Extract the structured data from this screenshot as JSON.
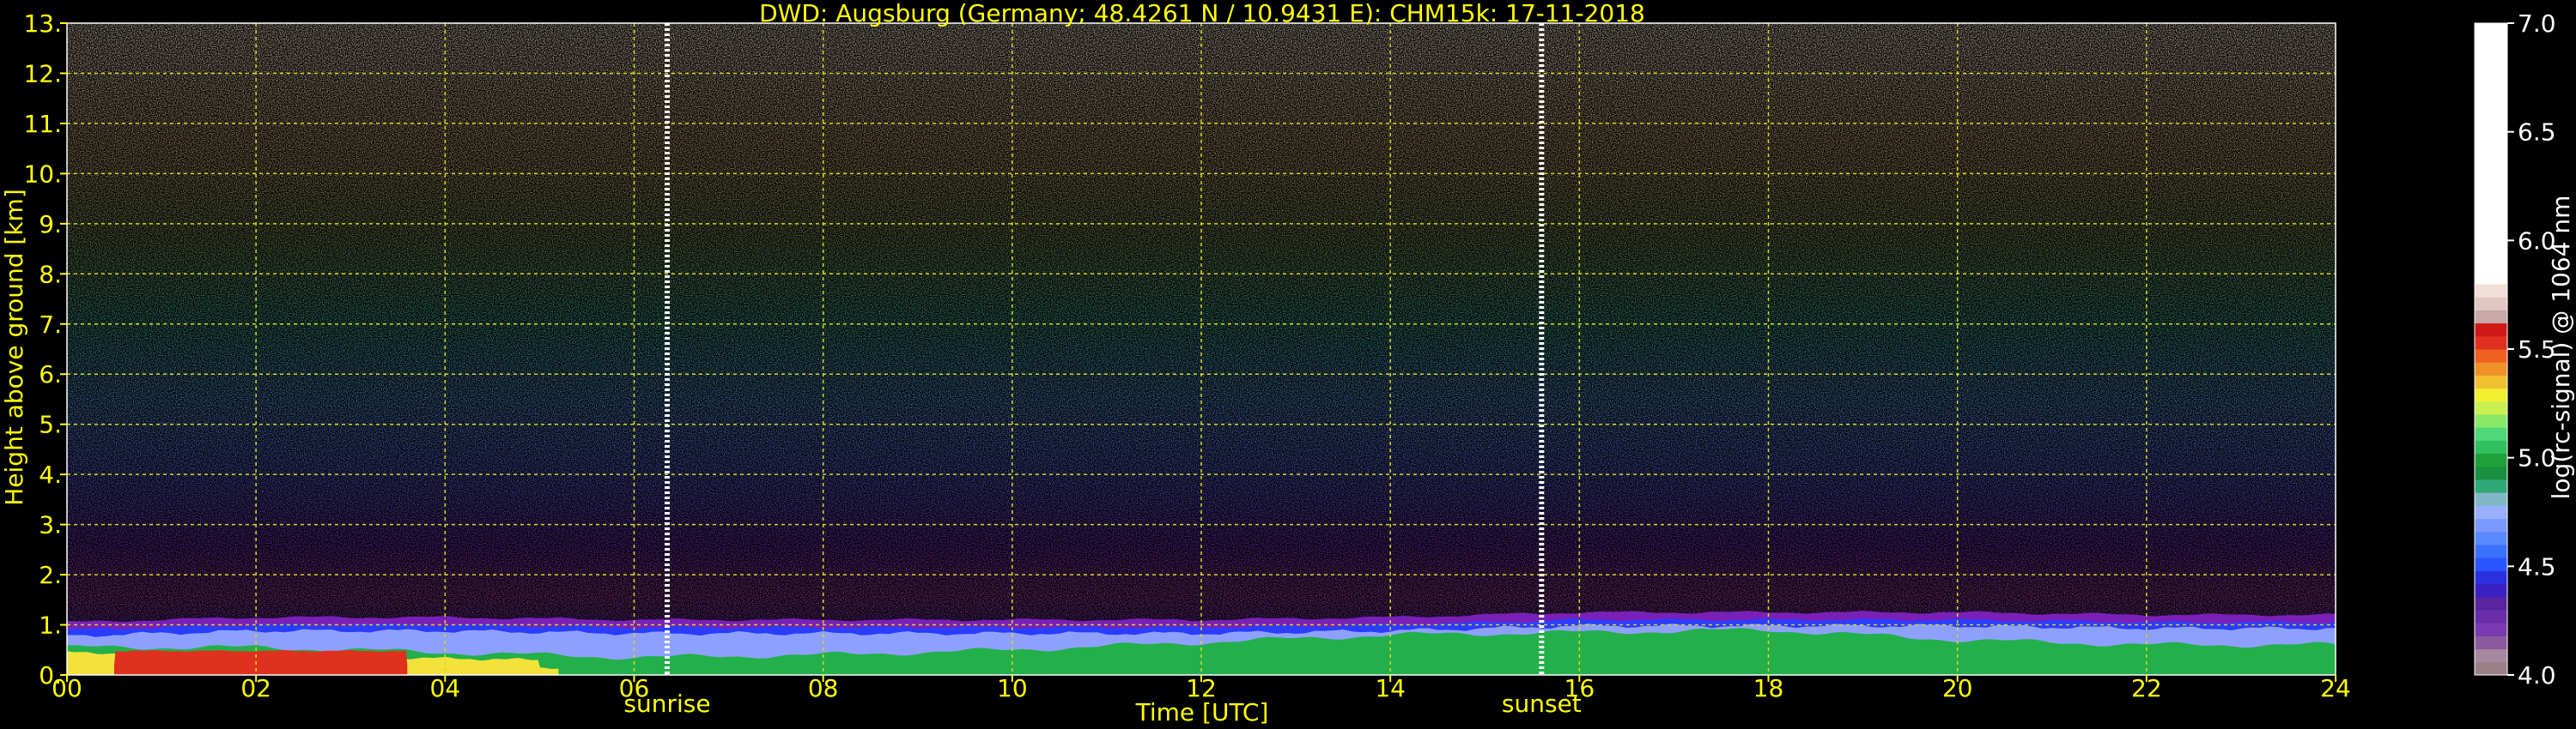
{
  "chart_data": {
    "type": "heatmap",
    "title": "DWD: Augsburg (Germany; 48.4261 N / 10.9431 E):    CHM15k: 17-11-2018",
    "xlabel": "Time [UTC]",
    "ylabel": "Height above ground [km]",
    "xlim": [
      0,
      24
    ],
    "ylim": [
      0,
      13
    ],
    "x_ticks": [
      "00",
      "02",
      "04",
      "06",
      "08",
      "10",
      "12",
      "14",
      "16",
      "18",
      "20",
      "22",
      "24"
    ],
    "y_ticks": [
      "0.",
      "1.",
      "2.",
      "3.",
      "4.",
      "5.",
      "6.",
      "7.",
      "8.",
      "9.",
      "10.",
      "11.",
      "12.",
      "13."
    ],
    "grid": true,
    "annotations": [
      {
        "label": "sunrise",
        "x": 6.35
      },
      {
        "label": "sunset",
        "x": 15.6
      }
    ],
    "colorbar": {
      "label": "log(rc-signal) @ 1064 nm",
      "range": [
        4.0,
        7.0
      ],
      "ticks": [
        "4.0",
        "4.5",
        "5.0",
        "5.5",
        "6.0",
        "6.5",
        "7.0"
      ]
    },
    "boundary_layer_top_km": {
      "times": [
        0,
        2,
        4,
        6,
        8,
        10,
        12,
        14,
        16,
        18,
        20,
        22,
        24
      ],
      "heights": [
        0.9,
        1.0,
        1.0,
        0.95,
        0.95,
        0.95,
        0.95,
        1.0,
        1.1,
        1.1,
        1.1,
        1.05,
        1.05
      ]
    },
    "strong_signal_top_km": {
      "times": [
        0,
        2,
        4,
        6,
        8,
        10,
        12,
        14,
        16,
        18,
        20,
        22,
        24
      ],
      "heights": [
        0.55,
        0.55,
        0.45,
        0.35,
        0.4,
        0.5,
        0.65,
        0.8,
        0.85,
        0.9,
        0.7,
        0.6,
        0.6
      ]
    }
  }
}
